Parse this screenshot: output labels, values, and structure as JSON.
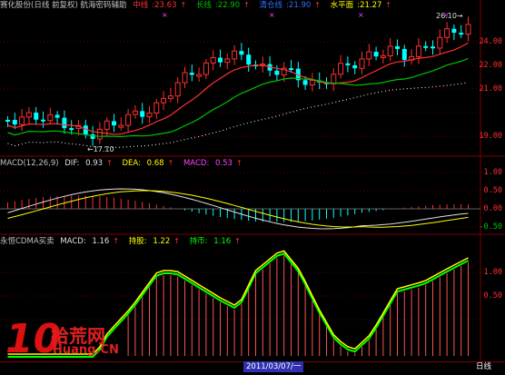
{
  "panels": {
    "price": {
      "title": "赛化股份(日线 前复权) 航海密码辅助",
      "items": [
        {
          "label": "中线",
          "value": "23.63",
          "color": "#ff3030"
        },
        {
          "label": "长线",
          "value": "22.90",
          "color": "#00c000"
        },
        {
          "label": "清仓线",
          "value": "21.90",
          "color": "#3070ff"
        },
        {
          "label": "水平面",
          "value": "21.27",
          "color": "#ffff00"
        }
      ],
      "axis_labels": [
        "24.00",
        "22.00",
        "21.00",
        "19.00"
      ],
      "high_label": "26.10",
      "low_label": "17.10"
    },
    "macd": {
      "title": "MACD(12,26,9)",
      "items": [
        {
          "label": "DIF:",
          "value": "0.93",
          "color": "#e0e0e0"
        },
        {
          "label": "DEA:",
          "value": "0.68",
          "color": "#ffff00"
        },
        {
          "label": "MACD:",
          "value": "0.53",
          "color": "#ff40ff"
        }
      ],
      "axis_labels": [
        "1.00",
        "0.50",
        "0.00",
        "-0.50"
      ]
    },
    "cdma": {
      "title": "永恒CDMA买卖",
      "items": [
        {
          "label": "MACD:",
          "value": "1.16",
          "color": "#e0e0e0"
        },
        {
          "label": "持股:",
          "value": "1.22",
          "color": "#ffff00"
        },
        {
          "label": "持币:",
          "value": "1.16",
          "color": "#00ff00"
        }
      ],
      "axis_labels": [
        "1.00",
        "0.50"
      ]
    }
  },
  "footer": {
    "date": "2011/03/07/一",
    "period": "日线"
  },
  "watermark": {
    "number": "10",
    "name": "拾荒网",
    "url": "Huang.CN"
  },
  "colors": {
    "up": "#ff3030",
    "down": "#00ffff",
    "mid_line": "#ff3030",
    "long_line": "#00c000",
    "clear_line": "#ffffff"
  }
}
